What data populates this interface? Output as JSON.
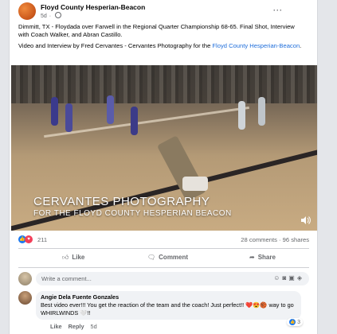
{
  "post": {
    "page_name": "Floyd County Hesperian-Beacon",
    "time": "5d",
    "more": "···",
    "text1": "Dimmitt, TX - Floydada over Farwell in the Regional Quarter Championship 68-65.  Final Shot, Interview with Coach Walker, and Abran Castillo.",
    "text2_prefix": "Video and Interview by Fred Cervantes - Cervantes Photography for the ",
    "text2_link": "Floyd County Hesperian-Beacon",
    "text2_suffix": "."
  },
  "video": {
    "overlay_line1": "CERVANTES PHOTOGRAPHY",
    "overlay_line2": "FOR THE FLOYD COUNTY HESPERIAN BEACON",
    "volume_icon": "speaker-icon"
  },
  "stats": {
    "reactions": "211",
    "comments": "28 comments",
    "shares": "96 shares",
    "like_color": "#1877f2",
    "love_color": "#f33e58"
  },
  "actions": {
    "like": "Like",
    "comment": "Comment",
    "share": "Share"
  },
  "comment_box": {
    "placeholder": "Write a comment...",
    "icons": [
      "emoji-icon",
      "camera-icon",
      "gif-icon",
      "sticker-icon"
    ]
  },
  "comment": {
    "author": "Angie Dela Fuente Gonzales",
    "text": "Best video ever!!! You get the reaction of the team and the coach! Just perfect!! ❤️😍🏀 way to go WHIRLWINDS 🤍!!",
    "like": "Like",
    "reply": "Reply",
    "time": "5d",
    "reaction_count": "3"
  }
}
